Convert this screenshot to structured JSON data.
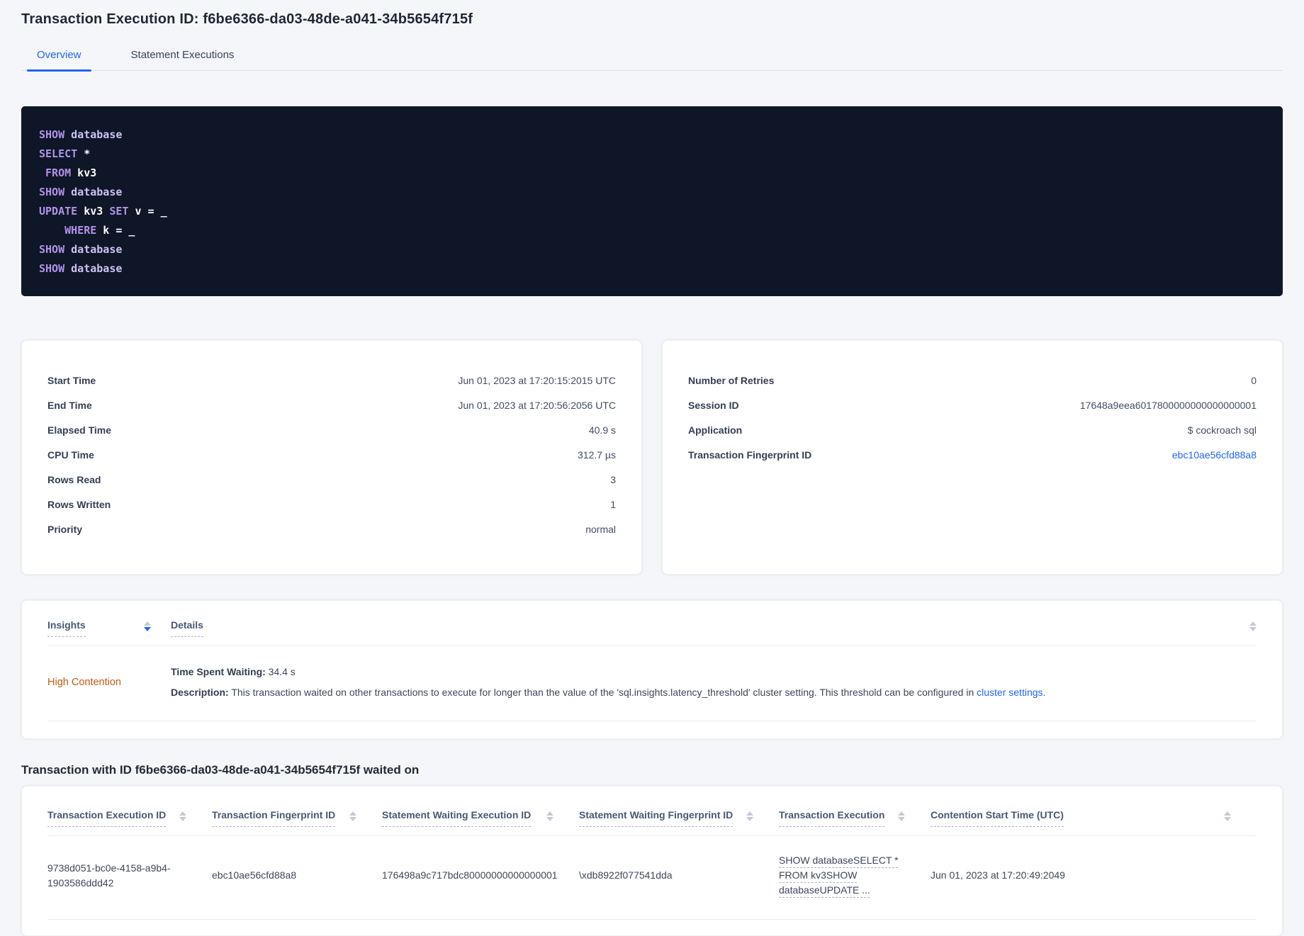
{
  "page": {
    "title": "Transaction Execution ID: f6be6366-da03-48de-a041-34b5654f715f"
  },
  "tabs": [
    {
      "label": "Overview",
      "active": true
    },
    {
      "label": "Statement Executions",
      "active": false
    }
  ],
  "colors": {
    "accent_blue": "#2265f1",
    "warning_orange": "#c05a12",
    "code_background": "#0e1627",
    "code_keyword_purple": "#b292e8",
    "code_secondary_lavender": "#cec2f4",
    "code_plain_white": "#fdfdff"
  },
  "sql_box": {
    "lines": [
      {
        "segments": [
          {
            "text": "SHOW"
          },
          {
            "text": " "
          },
          {
            "text": "database"
          }
        ]
      },
      {
        "segments": [
          {
            "text": "SELECT"
          },
          {
            "text": " *"
          }
        ]
      },
      {
        "segments": [
          {
            "text": " "
          },
          {
            "text": "FROM"
          },
          {
            "text": " kv3"
          }
        ]
      },
      {
        "segments": [
          {
            "text": "SHOW"
          },
          {
            "text": " "
          },
          {
            "text": "database"
          }
        ]
      },
      {
        "segments": [
          {
            "text": "UPDATE"
          },
          {
            "text": " kv3 "
          },
          {
            "text": "SET"
          },
          {
            "text": " v = _"
          }
        ]
      },
      {
        "segments": [
          {
            "text": "    "
          },
          {
            "text": "WHERE"
          },
          {
            "text": " k = _"
          }
        ]
      },
      {
        "segments": [
          {
            "text": "SHOW"
          },
          {
            "text": " "
          },
          {
            "text": "database"
          }
        ]
      },
      {
        "segments": [
          {
            "text": "SHOW"
          },
          {
            "text": " "
          },
          {
            "text": "database"
          }
        ]
      }
    ]
  },
  "summary_left": {
    "rows": [
      {
        "label": "Start Time",
        "value": "Jun 01, 2023 at 17:20:15:2015 UTC"
      },
      {
        "label": "End Time",
        "value": "Jun 01, 2023 at 17:20:56:2056 UTC"
      },
      {
        "label": "Elapsed Time",
        "value": "40.9 s"
      },
      {
        "label": "CPU Time",
        "value": "312.7 µs"
      },
      {
        "label": "Rows Read",
        "value": "3"
      },
      {
        "label": "Rows Written",
        "value": "1"
      },
      {
        "label": "Priority",
        "value": "normal"
      }
    ]
  },
  "summary_right": {
    "rows": [
      {
        "label": "Number of Retries",
        "value": "0"
      },
      {
        "label": "Session ID",
        "value": "17648a9eea6017800000000000000001"
      },
      {
        "label": "Application",
        "value": "$ cockroach sql"
      },
      {
        "label": "Transaction Fingerprint ID",
        "value": "ebc10ae56cfd88a8"
      }
    ]
  },
  "insights_table": {
    "col_insights": "Insights",
    "col_details": "Details",
    "row": {
      "insight": "High Contention",
      "waiting_label": "Time Spent Waiting:",
      "waiting_value": " 34.4 s",
      "description_label": "Description:",
      "description_text": " This transaction waited on other transactions to execute for longer than the value of the 'sql.insights.latency_threshold' cluster setting. This threshold can be configured in ",
      "description_link": "cluster settings",
      "description_suffix": "."
    }
  },
  "waited_section_title": "Transaction with ID f6be6366-da03-48de-a041-34b5654f715f waited on",
  "waited_table": {
    "columns": [
      {
        "label": "Transaction Execution ID"
      },
      {
        "label": "Transaction Fingerprint ID"
      },
      {
        "label": "Statement Waiting Execution ID"
      },
      {
        "label": "Statement Waiting Fingerprint ID"
      },
      {
        "label": "Transaction Execution"
      },
      {
        "label": "Contention Start Time (UTC)"
      }
    ],
    "row": {
      "transaction_execution_id": "9738d051-bc0e-4158-a9b4-1903586ddd42",
      "transaction_fingerprint_id": "ebc10ae56cfd88a8",
      "statement_waiting_execution_id": "176498a9c717bdc80000000000000001",
      "statement_waiting_fingerprint_id": "\\xdb8922f077541dda",
      "transaction_execution": "SHOW databaseSELECT * FROM kv3SHOW databaseUPDATE ...",
      "contention_start_time": "Jun 01, 2023 at 17:20:49:2049"
    }
  }
}
